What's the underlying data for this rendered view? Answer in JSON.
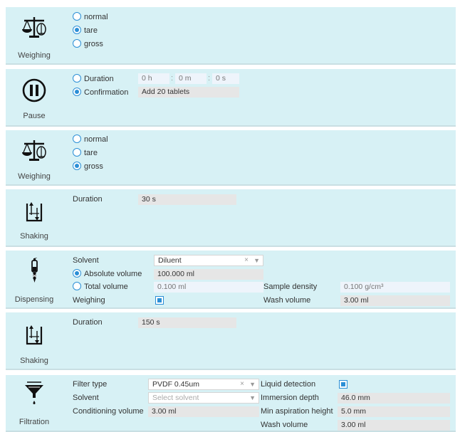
{
  "steps": [
    {
      "label": "Weighing",
      "icon": "balance-scale-icon",
      "modes": [
        {
          "label": "normal",
          "selected": false
        },
        {
          "label": "tare",
          "selected": true
        },
        {
          "label": "gross",
          "selected": false
        }
      ]
    },
    {
      "label": "Pause",
      "icon": "pause-icon",
      "duration_label": "Duration",
      "duration_selected": false,
      "hours": "0 h",
      "minutes": "0 m",
      "seconds": "0 s",
      "confirmation_label": "Confirmation",
      "confirmation_selected": true,
      "confirmation_text": "Add 20 tablets"
    },
    {
      "label": "Weighing",
      "icon": "balance-scale-icon",
      "modes": [
        {
          "label": "normal",
          "selected": false
        },
        {
          "label": "tare",
          "selected": false
        },
        {
          "label": "gross",
          "selected": true
        }
      ]
    },
    {
      "label": "Shaking",
      "icon": "shaking-icon",
      "duration_label": "Duration",
      "duration": "30 s"
    },
    {
      "label": "Dispensing",
      "icon": "dispenser-icon",
      "solvent_label": "Solvent",
      "solvent": "Diluent",
      "absolute_label": "Absolute volume",
      "absolute_selected": true,
      "absolute_value": "100.000 ml",
      "total_label": "Total volume",
      "total_selected": false,
      "total_value": "0.100 ml",
      "weighing_label": "Weighing",
      "weighing_checked": true,
      "density_label": "Sample density",
      "density_value": "0.100 g/cm³",
      "wash_label": "Wash volume",
      "wash_value": "3.00 ml"
    },
    {
      "label": "Shaking",
      "icon": "shaking-icon",
      "duration_label": "Duration",
      "duration": "150 s"
    },
    {
      "label": "Filtration",
      "icon": "funnel-icon",
      "filter_label": "Filter type",
      "filter_value": "PVDF 0.45um",
      "solvent_label": "Solvent",
      "solvent_placeholder": "Select solvent",
      "conditioning_label": "Conditioning volume",
      "conditioning_value": "3.00 ml",
      "liquid_label": "Liquid detection",
      "liquid_checked": true,
      "immersion_label": "Immersion depth",
      "immersion_value": "46.0 mm",
      "min_asp_label": "Min aspiration height",
      "min_asp_value": "5.0 mm",
      "wash_label": "Wash volume",
      "wash_value": "3.00 ml"
    }
  ],
  "glyphs": {
    "clear": "×",
    "dropdown": "▼",
    "colon": ":"
  }
}
